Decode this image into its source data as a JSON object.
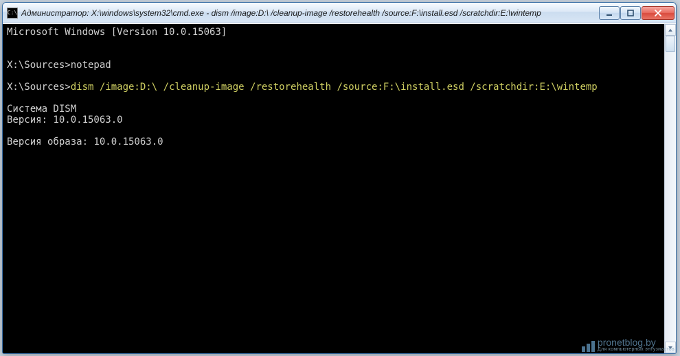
{
  "window": {
    "icon_glyph": "C:\\",
    "title": "Администратор: X:\\windows\\system32\\cmd.exe - dism  /image:D:\\  /cleanup-image /restorehealth /source:F:\\install.esd /scratchdir:E:\\wintemp"
  },
  "controls": {
    "minimize_tip": "Minimize",
    "maximize_tip": "Maximize",
    "close_tip": "Close"
  },
  "console": {
    "line1": "Microsoft Windows [Version 10.0.15063]",
    "blank": "",
    "prompt1": "X:\\Sources>",
    "cmd1": "notepad",
    "prompt2": "X:\\Sources>",
    "cmd2": "dism /image:D:\\ /cleanup-image /restorehealth /source:F:\\install.esd /scratchdir:E:\\wintemp",
    "out1": "Cистема DISM",
    "out2": "Версия: 10.0.15063.0",
    "out3": "Версия образа: 10.0.15063.0"
  },
  "watermark": {
    "brand": "pronetblog.by",
    "tagline": "Для компьютерных энтузиастов"
  }
}
